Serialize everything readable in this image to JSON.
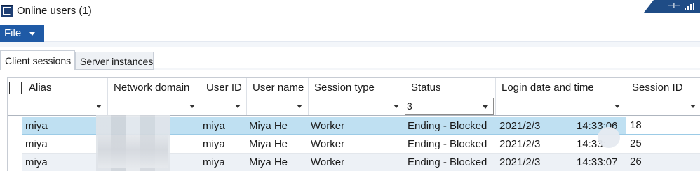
{
  "window": {
    "title": "Online users (1)"
  },
  "menu": {
    "file_label": "File"
  },
  "tabs": [
    {
      "label": "Client sessions",
      "selected": true
    },
    {
      "label": "Server instances",
      "selected": false
    }
  ],
  "grid": {
    "columns": [
      {
        "label": "Alias",
        "filter": ""
      },
      {
        "label": "Network domain",
        "filter": ""
      },
      {
        "label": "User ID",
        "filter": ""
      },
      {
        "label": "User name",
        "filter": ""
      },
      {
        "label": "Session type",
        "filter": ""
      },
      {
        "label": "Status",
        "filter": "3"
      },
      {
        "label": "Login date and time",
        "filter": ""
      },
      {
        "label": "Session ID",
        "filter": ""
      }
    ],
    "rows": [
      {
        "alias": "miya",
        "network_domain": "",
        "user_id": "miya",
        "user_name": "Miya He",
        "session_type": "Worker",
        "status": "Ending - Blocked",
        "login_date": "2021/2/3",
        "login_time": "14:33:06",
        "session_id": "18"
      },
      {
        "alias": "miya",
        "network_domain": "",
        "user_id": "miya",
        "user_name": "Miya He",
        "session_type": "Worker",
        "status": "Ending - Blocked",
        "login_date": "2021/2/3",
        "login_time": "14:33:",
        "session_id": "25"
      },
      {
        "alias": "miya",
        "network_domain": "",
        "user_id": "miya",
        "user_name": "Miya He",
        "session_type": "Worker",
        "status": "Ending - Blocked",
        "login_date": "2021/2/3",
        "login_time": "14:33:07",
        "session_id": "26"
      }
    ],
    "selected_row": 0
  },
  "colors": {
    "menu_accent": "#1f5aa6",
    "selected_row": "#bfe0f2",
    "alt_row": "#edf1f6"
  },
  "icons": [
    "app-logo-icon",
    "pin-icon",
    "signal-icon",
    "dropdown-caret-icon"
  ]
}
